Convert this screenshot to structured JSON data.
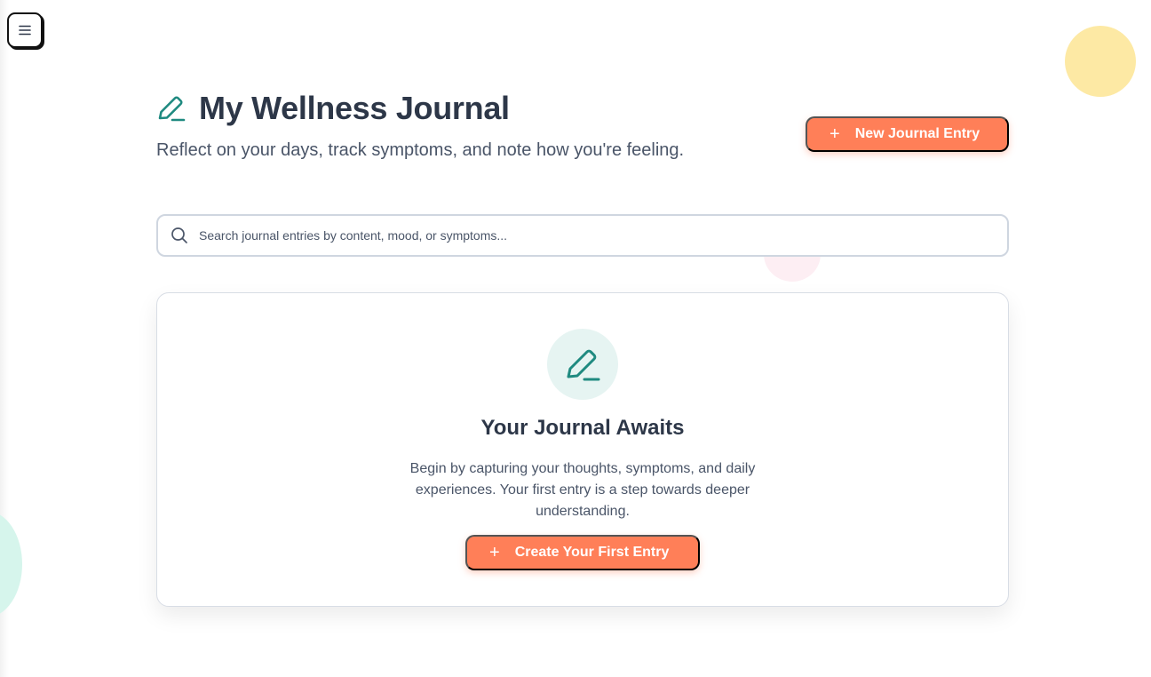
{
  "header": {
    "title": "My Wellness Journal",
    "subtitle": "Reflect on your days, track symptoms, and note how you're feeling.",
    "new_entry_label": "New Journal Entry"
  },
  "search": {
    "placeholder": "Search journal entries by content, mood, or symptoms..."
  },
  "empty_state": {
    "title": "Your Journal Awaits",
    "text": "Begin by capturing your thoughts, symptoms, and daily experiences. Your first entry is a step towards deeper understanding.",
    "cta_label": "Create Your First Entry"
  },
  "icons": {
    "menu": "menu-icon",
    "pen": "pen-icon",
    "search": "search-icon",
    "plus": "plus-icon"
  },
  "colors": {
    "accent": "#ff7f58",
    "teal": "#1f8a80",
    "text": "#2d3748",
    "muted": "#4a5568"
  }
}
